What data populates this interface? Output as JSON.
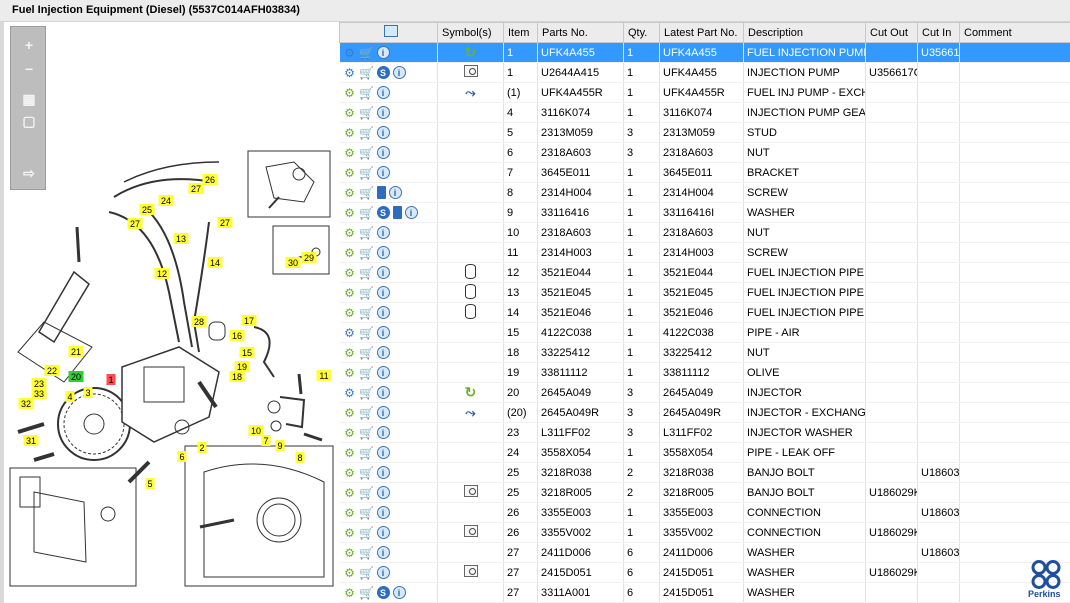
{
  "window": {
    "title": "Fuel Injection Equipment (Diesel) (5537C014AFH03834)"
  },
  "toolbar": {
    "zoom_in": "+",
    "zoom_out": "−",
    "fit": "▦",
    "reset": "▢",
    "export": "⇨"
  },
  "diagram": {
    "callouts": [
      "26",
      "27",
      "25",
      "24",
      "27",
      "13",
      "27",
      "12",
      "14",
      "21",
      "22",
      "28",
      "16",
      "17",
      "15",
      "19",
      "18",
      "11",
      "23",
      "33",
      "20",
      "1",
      "3",
      "4",
      "32",
      "31",
      "10",
      "7",
      "9",
      "8",
      "6",
      "2",
      "5",
      "30",
      "29"
    ],
    "highlight_callout": "20",
    "red_callout": "1"
  },
  "table": {
    "columns": [
      "",
      "Symbol(s)",
      "Item",
      "Parts No.",
      "Qty.",
      "Latest Part No.",
      "Description",
      "Cut Out",
      "Cut In",
      "Comment"
    ],
    "rows": [
      {
        "icons": [
          "gear-blue",
          "cart",
          "info"
        ],
        "symbol": "cycle",
        "item": "1",
        "part": "UFK4A455",
        "qty": "1",
        "latest": "UFK4A455",
        "desc": "FUEL INJECTION PUMP",
        "cutout": "",
        "cutin": "U35661",
        "selected": true
      },
      {
        "icons": [
          "gear-blue",
          "cart",
          "s",
          "info"
        ],
        "symbol": "mag",
        "item": "1",
        "part": "U2644A415",
        "qty": "1",
        "latest": "UFK4A455",
        "desc": "INJECTION PUMP",
        "cutout": "U356617C",
        "cutin": ""
      },
      {
        "icons": [
          "gear",
          "cart",
          "info"
        ],
        "symbol": "arrow",
        "item": "(1)",
        "part": "UFK4A455R",
        "qty": "1",
        "latest": "UFK4A455R",
        "desc": "FUEL INJ PUMP - EXCH",
        "cutout": "",
        "cutin": ""
      },
      {
        "icons": [
          "gear",
          "cart",
          "info"
        ],
        "symbol": "",
        "item": "4",
        "part": "3116K074",
        "qty": "1",
        "latest": "3116K074",
        "desc": "INJECTION PUMP GEAR",
        "cutout": "",
        "cutin": ""
      },
      {
        "icons": [
          "gear",
          "cart",
          "info"
        ],
        "symbol": "",
        "item": "5",
        "part": "2313M059",
        "qty": "3",
        "latest": "2313M059",
        "desc": "STUD",
        "cutout": "",
        "cutin": ""
      },
      {
        "icons": [
          "gear",
          "cart",
          "info"
        ],
        "symbol": "",
        "item": "6",
        "part": "2318A603",
        "qty": "3",
        "latest": "2318A603",
        "desc": "NUT",
        "cutout": "",
        "cutin": ""
      },
      {
        "icons": [
          "gear",
          "cart",
          "info"
        ],
        "symbol": "",
        "item": "7",
        "part": "3645E011",
        "qty": "1",
        "latest": "3645E011",
        "desc": "BRACKET",
        "cutout": "",
        "cutin": ""
      },
      {
        "icons": [
          "gear",
          "cart",
          "book",
          "info"
        ],
        "symbol": "",
        "item": "8",
        "part": "2314H004",
        "qty": "1",
        "latest": "2314H004",
        "desc": "SCREW",
        "cutout": "",
        "cutin": ""
      },
      {
        "icons": [
          "gear",
          "cart",
          "s",
          "book",
          "info"
        ],
        "symbol": "",
        "item": "9",
        "part": "33116416",
        "qty": "1",
        "latest": "33116416I",
        "desc": "WASHER",
        "cutout": "",
        "cutin": ""
      },
      {
        "icons": [
          "gear",
          "cart",
          "info"
        ],
        "symbol": "",
        "item": "10",
        "part": "2318A603",
        "qty": "1",
        "latest": "2318A603",
        "desc": "NUT",
        "cutout": "",
        "cutin": ""
      },
      {
        "icons": [
          "gear",
          "cart",
          "info"
        ],
        "symbol": "",
        "item": "11",
        "part": "2314H003",
        "qty": "1",
        "latest": "2314H003",
        "desc": "SCREW",
        "cutout": "",
        "cutin": ""
      },
      {
        "icons": [
          "gear",
          "cart",
          "info"
        ],
        "symbol": "cyl",
        "item": "12",
        "part": "3521E044",
        "qty": "1",
        "latest": "3521E044",
        "desc": "FUEL INJECTION PIPE",
        "cutout": "",
        "cutin": ""
      },
      {
        "icons": [
          "gear",
          "cart",
          "info"
        ],
        "symbol": "cyl",
        "item": "13",
        "part": "3521E045",
        "qty": "1",
        "latest": "3521E045",
        "desc": "FUEL INJECTION PIPE",
        "cutout": "",
        "cutin": ""
      },
      {
        "icons": [
          "gear",
          "cart",
          "info"
        ],
        "symbol": "cyl",
        "item": "14",
        "part": "3521E046",
        "qty": "1",
        "latest": "3521E046",
        "desc": "FUEL INJECTION PIPE",
        "cutout": "",
        "cutin": ""
      },
      {
        "icons": [
          "gear-blue",
          "cart",
          "info"
        ],
        "symbol": "",
        "item": "15",
        "part": "4122C038",
        "qty": "1",
        "latest": "4122C038",
        "desc": "PIPE - AIR",
        "cutout": "",
        "cutin": ""
      },
      {
        "icons": [
          "gear",
          "cart",
          "info"
        ],
        "symbol": "",
        "item": "18",
        "part": "33225412",
        "qty": "1",
        "latest": "33225412",
        "desc": "NUT",
        "cutout": "",
        "cutin": ""
      },
      {
        "icons": [
          "gear",
          "cart",
          "info"
        ],
        "symbol": "",
        "item": "19",
        "part": "33811112",
        "qty": "1",
        "latest": "33811112",
        "desc": "OLIVE",
        "cutout": "",
        "cutin": ""
      },
      {
        "icons": [
          "gear-blue",
          "cart",
          "info"
        ],
        "symbol": "cycle",
        "item": "20",
        "part": "2645A049",
        "qty": "3",
        "latest": "2645A049",
        "desc": "INJECTOR",
        "cutout": "",
        "cutin": ""
      },
      {
        "icons": [
          "gear",
          "cart",
          "info"
        ],
        "symbol": "arrow",
        "item": "(20)",
        "part": "2645A049R",
        "qty": "3",
        "latest": "2645A049R",
        "desc": "INJECTOR - EXCHANGE",
        "cutout": "",
        "cutin": ""
      },
      {
        "icons": [
          "gear",
          "cart",
          "info"
        ],
        "symbol": "",
        "item": "23",
        "part": "L311FF02",
        "qty": "3",
        "latest": "L311FF02",
        "desc": "INJECTOR WASHER",
        "cutout": "",
        "cutin": ""
      },
      {
        "icons": [
          "gear",
          "cart",
          "info"
        ],
        "symbol": "",
        "item": "24",
        "part": "3558X054",
        "qty": "1",
        "latest": "3558X054",
        "desc": "PIPE - LEAK OFF",
        "cutout": "",
        "cutin": ""
      },
      {
        "icons": [
          "gear",
          "cart",
          "info"
        ],
        "symbol": "",
        "item": "25",
        "part": "3218R038",
        "qty": "2",
        "latest": "3218R038",
        "desc": "BANJO BOLT",
        "cutout": "",
        "cutin": "U18603"
      },
      {
        "icons": [
          "gear",
          "cart",
          "info"
        ],
        "symbol": "mag",
        "item": "25",
        "part": "3218R005",
        "qty": "2",
        "latest": "3218R005",
        "desc": "BANJO BOLT",
        "cutout": "U186029K",
        "cutin": ""
      },
      {
        "icons": [
          "gear",
          "cart",
          "info"
        ],
        "symbol": "",
        "item": "26",
        "part": "3355E003",
        "qty": "1",
        "latest": "3355E003",
        "desc": "CONNECTION",
        "cutout": "",
        "cutin": "U18603"
      },
      {
        "icons": [
          "gear",
          "cart",
          "info"
        ],
        "symbol": "mag",
        "item": "26",
        "part": "3355V002",
        "qty": "1",
        "latest": "3355V002",
        "desc": "CONNECTION",
        "cutout": "U186029K",
        "cutin": ""
      },
      {
        "icons": [
          "gear",
          "cart",
          "info"
        ],
        "symbol": "",
        "item": "27",
        "part": "2411D006",
        "qty": "6",
        "latest": "2411D006",
        "desc": "WASHER",
        "cutout": "",
        "cutin": "U18603"
      },
      {
        "icons": [
          "gear",
          "cart",
          "info"
        ],
        "symbol": "mag",
        "item": "27",
        "part": "2415D051",
        "qty": "6",
        "latest": "2415D051",
        "desc": "WASHER",
        "cutout": "U186029K",
        "cutin": ""
      },
      {
        "icons": [
          "gear",
          "cart",
          "s",
          "info"
        ],
        "symbol": "",
        "item": "27",
        "part": "3311A001",
        "qty": "6",
        "latest": "2415D051",
        "desc": "WASHER",
        "cutout": "",
        "cutin": ""
      }
    ]
  },
  "logo": {
    "text": "Perkins",
    "color": "#1f4f9f"
  },
  "colors": {
    "selected_row": "#3399ff",
    "callout": "#ffff33",
    "callout_green": "#33cc33"
  }
}
